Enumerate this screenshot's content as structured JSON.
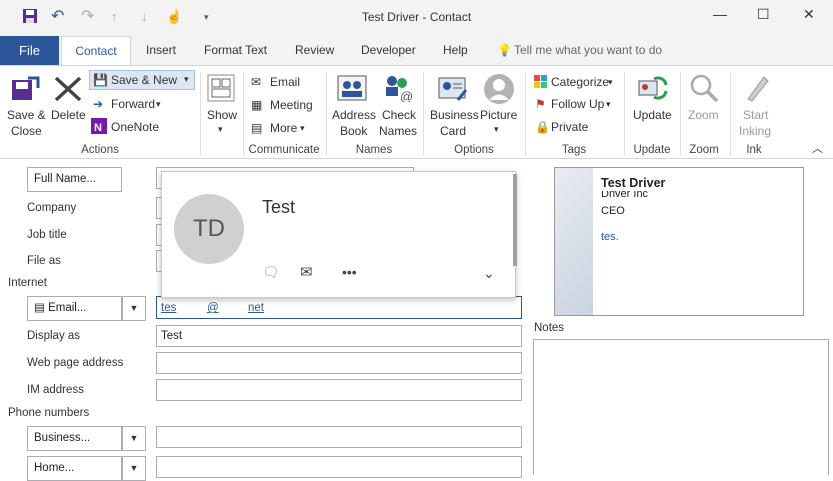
{
  "window": {
    "title": "Test Driver  -  Contact"
  },
  "tabs": [
    "File",
    "Contact",
    "Insert",
    "Format Text",
    "Review",
    "Developer",
    "Help"
  ],
  "tell_me": "Tell me what you want to do",
  "ribbon": {
    "save_close": [
      "Save &",
      "Close"
    ],
    "delete": "Delete",
    "save_new": "Save & New",
    "forward": "Forward",
    "onenote": "OneNote",
    "show": "Show",
    "email": "Email",
    "meeting": "Meeting",
    "more": "More",
    "address_book": [
      "Address",
      "Book"
    ],
    "check_names": [
      "Check",
      "Names"
    ],
    "business_card": [
      "Business",
      "Card"
    ],
    "picture": "Picture",
    "categorize": "Categorize",
    "follow_up": "Follow Up",
    "private": "Private",
    "update": "Update",
    "zoom": "Zoom",
    "start_inking": [
      "Start",
      "Inking"
    ],
    "groups": [
      "Actions",
      "Communicate",
      "Names",
      "Options",
      "Tags",
      "Update",
      "Zoom",
      "Ink"
    ]
  },
  "form": {
    "full_name_btn": "Full Name...",
    "company": "Company",
    "job_title": "Job title",
    "file_as": "File as",
    "internet": "Internet",
    "email_btn": "Email...",
    "email_value": [
      "tes",
      "@",
      "net"
    ],
    "display_as": "Display as",
    "display_value": "Test",
    "web_page": "Web page address",
    "im_address": "IM address",
    "phone_numbers": "Phone numbers",
    "business_btn": "Business...",
    "home_btn": "Home...",
    "notes": "Notes"
  },
  "card_popup": {
    "initials": "TD",
    "name": "Test"
  },
  "business_card": {
    "name": "Test Driver",
    "company": "Driver Inc",
    "title": "CEO",
    "email": "tes."
  },
  "colors": {
    "accent": "#2b579a",
    "avatar": "#d0d0d0"
  }
}
